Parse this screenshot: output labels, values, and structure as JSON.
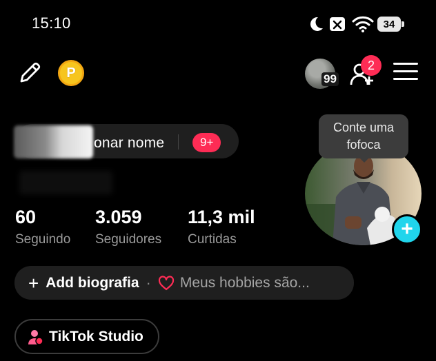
{
  "status_bar": {
    "time": "15:10",
    "battery": "34"
  },
  "header": {
    "avatar_count": "99",
    "notifications": "2"
  },
  "profile": {
    "name_action": "onar nome",
    "messages_badge": "9+",
    "tooltip_line1": "Conte uma",
    "tooltip_line2": "fofoca"
  },
  "stats": [
    {
      "value": "60",
      "label": "Seguindo"
    },
    {
      "value": "3.059",
      "label": "Seguidores"
    },
    {
      "value": "11,3 mil",
      "label": "Curtidas"
    }
  ],
  "bio": {
    "add_label": "Add biografia",
    "separator": "·",
    "hobby_prompt": "Meus hobbies são..."
  },
  "studio": {
    "label": "TikTok Studio"
  },
  "colors": {
    "accent_red": "#fe2c55",
    "accent_cyan": "#20d5ec",
    "coin_gold": "#f7c51e"
  }
}
